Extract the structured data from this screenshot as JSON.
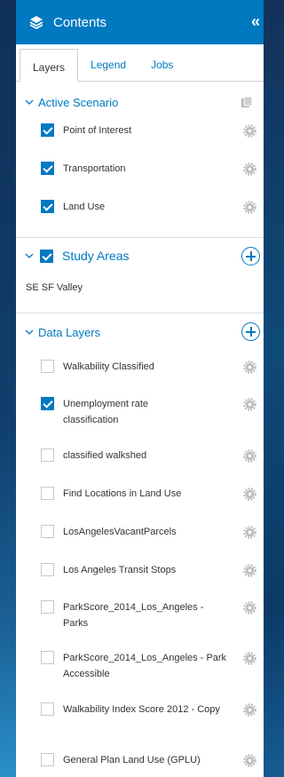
{
  "header": {
    "title": "Contents",
    "collapse": "«"
  },
  "tabs": [
    {
      "label": "Layers"
    },
    {
      "label": "Legend"
    },
    {
      "label": "Jobs"
    }
  ],
  "active_scenario": {
    "title": "Active Scenario",
    "items": [
      {
        "label": "Point of Interest",
        "checked": true
      },
      {
        "label": "Transportation",
        "checked": true
      },
      {
        "label": "Land Use",
        "checked": true
      }
    ]
  },
  "study_areas": {
    "title": "Study Areas",
    "checked": true,
    "items": [
      {
        "label": "SE SF Valley"
      }
    ]
  },
  "data_layers": {
    "title": "Data Layers",
    "items": [
      {
        "label": "Walkability Classified",
        "checked": false
      },
      {
        "label": "Unemployment rate classification",
        "checked": true
      },
      {
        "label": "classified walkshed",
        "checked": false
      },
      {
        "label": "Find Locations in Land Use",
        "checked": false
      },
      {
        "label": "LosAngelesVacantParcels",
        "checked": false
      },
      {
        "label": "Los Angeles Transit Stops",
        "checked": false
      },
      {
        "label": "ParkScore_2014_Los_Angeles - Parks",
        "checked": false
      },
      {
        "label": "ParkScore_2014_Los_Angeles - Park Accessible",
        "checked": false
      },
      {
        "label": "Walkability Index Score 2012 - Copy",
        "checked": false
      },
      {
        "label": "General Plan Land Use (GPLU)",
        "checked": false
      }
    ]
  },
  "colors": {
    "accent": "#0079c1",
    "header_bg": "#0079c1",
    "text": "#333333",
    "icon_gray": "#b5b5b5"
  },
  "icons": [
    "layers-icon",
    "collapse-icon",
    "chevron-down-icon",
    "copy-icon",
    "gear-icon",
    "add-icon",
    "checkbox"
  ]
}
